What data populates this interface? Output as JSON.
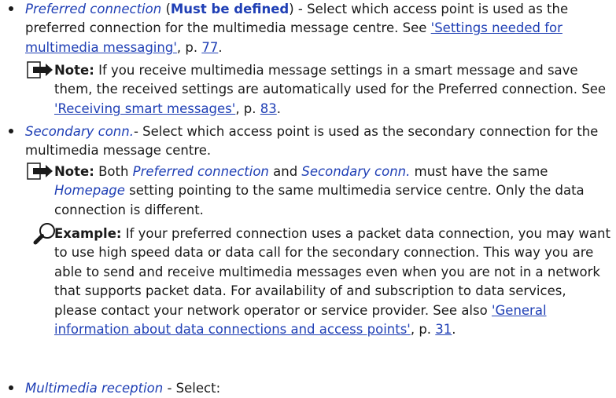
{
  "b1": {
    "term": "Preferred connection",
    "open_paren": " (",
    "must": "Must be defined",
    "close": ")",
    "text": " - Select which access point is used as the preferred connection for the multimedia message centre. See ",
    "link": "'Settings needed for multimedia messaging'",
    "pre_page": ", p. ",
    "page": "77",
    "end": "."
  },
  "note1": {
    "label": "Note:",
    "text": " If you receive multimedia message settings in a smart message and save them, the received settings are automatically used for the Preferred connection. See ",
    "link": "'Receiving smart messages'",
    "pre_page": ", p. ",
    "page": "83",
    "end": "."
  },
  "b2": {
    "term": "Secondary conn.",
    "text": "- Select which access point is used as the secondary connection for the multimedia message centre."
  },
  "note2": {
    "label": "Note:",
    "t1": " Both ",
    "term1": "Preferred connection",
    "t2": " and ",
    "term2": "Secondary conn.",
    "t3": " must have the same ",
    "term3": "Homepage",
    "t4": " setting pointing to the same multimedia service centre. Only the data connection is different."
  },
  "example": {
    "label": "Example:",
    "text": " If your preferred connection uses a packet data connection, you may want to use high speed data or data call for the secondary connection. This way you are able to send and receive multimedia messages even when you are not in a network that supports packet data. For availability of and subscription to data services, please contact your network operator or service provider. See also ",
    "link": "'General information about data connections and access points'",
    "pre_page": ", p. ",
    "page": "31",
    "end": "."
  },
  "b3": {
    "term": "Multimedia reception",
    "text": " - Select:"
  },
  "icons": {
    "note": "note-icon",
    "example": "magnifier-icon"
  },
  "colors": {
    "accent": "#1f3fb5",
    "text": "#1a1a1a"
  }
}
